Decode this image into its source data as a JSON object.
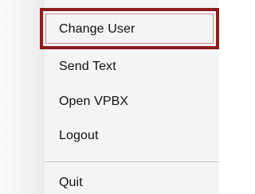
{
  "menu": {
    "items": [
      {
        "label": "Change User",
        "highlighted": true
      },
      {
        "label": "Send Text"
      },
      {
        "label": "Open VPBX"
      },
      {
        "label": "Logout"
      },
      {
        "label": "Quit"
      }
    ]
  },
  "colors": {
    "highlight_border": "#8e1d1d",
    "menu_background": "#f4f4f4",
    "separator": "#c7c7c7",
    "text": "#111111"
  }
}
